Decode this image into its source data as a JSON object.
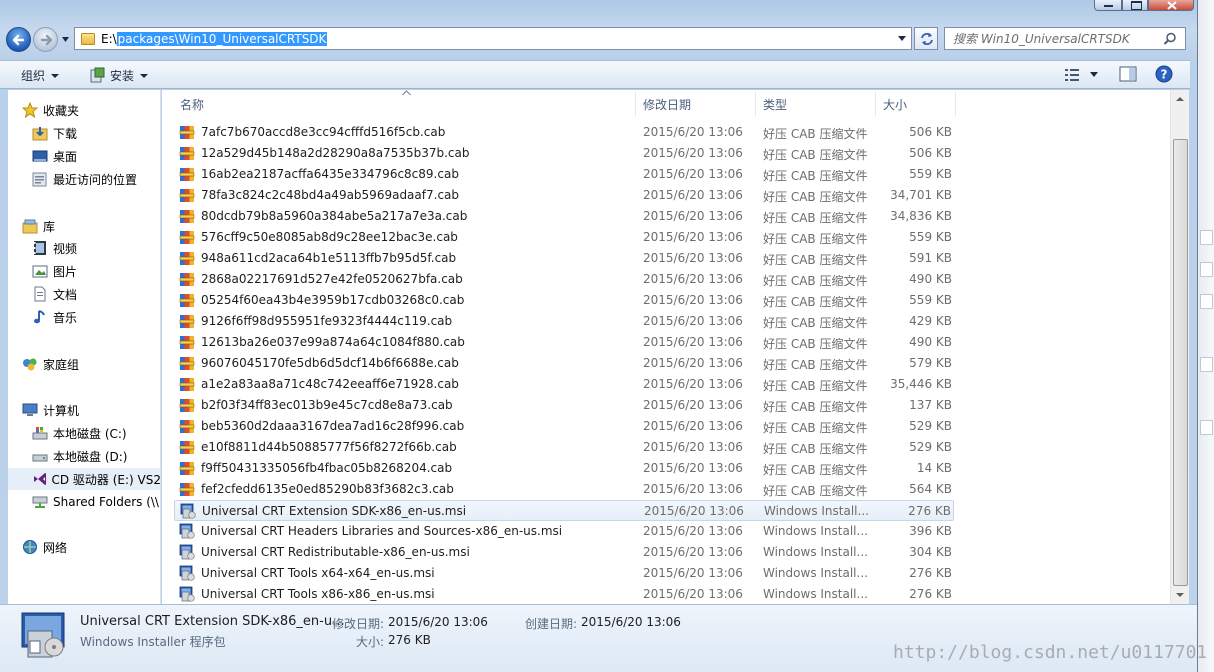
{
  "address": {
    "prefix": "E:\\",
    "selected_path": "packages\\Win10_UniversalCRTSDK"
  },
  "search": {
    "placeholder": "搜索 Win10_UniversalCRTSDK"
  },
  "toolbar": {
    "organize": "组织",
    "install": "安装"
  },
  "nav": {
    "favorites": "收藏夹",
    "downloads": "下载",
    "desktop": "桌面",
    "recent": "最近访问的位置",
    "libraries": "库",
    "videos": "视频",
    "pictures": "图片",
    "documents": "文档",
    "music": "音乐",
    "homegroup": "家庭组",
    "computer": "计算机",
    "drive_c": "本地磁盘 (C:)",
    "drive_d": "本地磁盘 (D:)",
    "drive_e": "CD 驱动器 (E:) VS2",
    "shared": "Shared Folders (\\\\",
    "network": "网络"
  },
  "columns": {
    "name": "名称",
    "date": "修改日期",
    "type": "类型",
    "size": "大小"
  },
  "files": [
    {
      "name": "7afc7b670accd8e3cc94cfffd516f5cb.cab",
      "date": "2015/6/20 13:06",
      "type": "好压 CAB 压缩文件",
      "size": "506 KB",
      "kind": "cab"
    },
    {
      "name": "12a529d45b148a2d28290a8a7535b37b.cab",
      "date": "2015/6/20 13:06",
      "type": "好压 CAB 压缩文件",
      "size": "506 KB",
      "kind": "cab"
    },
    {
      "name": "16ab2ea2187acffa6435e334796c8c89.cab",
      "date": "2015/6/20 13:06",
      "type": "好压 CAB 压缩文件",
      "size": "559 KB",
      "kind": "cab"
    },
    {
      "name": "78fa3c824c2c48bd4a49ab5969adaaf7.cab",
      "date": "2015/6/20 13:06",
      "type": "好压 CAB 压缩文件",
      "size": "34,701 KB",
      "kind": "cab"
    },
    {
      "name": "80dcdb79b8a5960a384abe5a217a7e3a.cab",
      "date": "2015/6/20 13:06",
      "type": "好压 CAB 压缩文件",
      "size": "34,836 KB",
      "kind": "cab"
    },
    {
      "name": "576cff9c50e8085ab8d9c28ee12bac3e.cab",
      "date": "2015/6/20 13:06",
      "type": "好压 CAB 压缩文件",
      "size": "559 KB",
      "kind": "cab"
    },
    {
      "name": "948a611cd2aca64b1e5113ffb7b95d5f.cab",
      "date": "2015/6/20 13:06",
      "type": "好压 CAB 压缩文件",
      "size": "591 KB",
      "kind": "cab"
    },
    {
      "name": "2868a02217691d527e42fe0520627bfa.cab",
      "date": "2015/6/20 13:06",
      "type": "好压 CAB 压缩文件",
      "size": "490 KB",
      "kind": "cab"
    },
    {
      "name": "05254f60ea43b4e3959b17cdb03268c0.cab",
      "date": "2015/6/20 13:06",
      "type": "好压 CAB 压缩文件",
      "size": "559 KB",
      "kind": "cab"
    },
    {
      "name": "9126f6ff98d955951fe9323f4444c119.cab",
      "date": "2015/6/20 13:06",
      "type": "好压 CAB 压缩文件",
      "size": "429 KB",
      "kind": "cab"
    },
    {
      "name": "12613ba26e037e99a874a64c1084f880.cab",
      "date": "2015/6/20 13:06",
      "type": "好压 CAB 压缩文件",
      "size": "490 KB",
      "kind": "cab"
    },
    {
      "name": "96076045170fe5db6d5dcf14b6f6688e.cab",
      "date": "2015/6/20 13:06",
      "type": "好压 CAB 压缩文件",
      "size": "579 KB",
      "kind": "cab"
    },
    {
      "name": "a1e2a83aa8a71c48c742eeaff6e71928.cab",
      "date": "2015/6/20 13:06",
      "type": "好压 CAB 压缩文件",
      "size": "35,446 KB",
      "kind": "cab"
    },
    {
      "name": "b2f03f34ff83ec013b9e45c7cd8e8a73.cab",
      "date": "2015/6/20 13:06",
      "type": "好压 CAB 压缩文件",
      "size": "137 KB",
      "kind": "cab"
    },
    {
      "name": "beb5360d2daaa3167dea7ad16c28f996.cab",
      "date": "2015/6/20 13:06",
      "type": "好压 CAB 压缩文件",
      "size": "529 KB",
      "kind": "cab"
    },
    {
      "name": "e10f8811d44b50885777f56f8272f66b.cab",
      "date": "2015/6/20 13:06",
      "type": "好压 CAB 压缩文件",
      "size": "529 KB",
      "kind": "cab"
    },
    {
      "name": "f9ff50431335056fb4fbac05b8268204.cab",
      "date": "2015/6/20 13:06",
      "type": "好压 CAB 压缩文件",
      "size": "14 KB",
      "kind": "cab"
    },
    {
      "name": "fef2cfedd6135e0ed85290b83f3682c3.cab",
      "date": "2015/6/20 13:06",
      "type": "好压 CAB 压缩文件",
      "size": "564 KB",
      "kind": "cab"
    },
    {
      "name": "Universal CRT Extension SDK-x86_en-us.msi",
      "date": "2015/6/20 13:06",
      "type": "Windows Install...",
      "size": "276 KB",
      "kind": "msi",
      "selected": true
    },
    {
      "name": "Universal CRT Headers Libraries and Sources-x86_en-us.msi",
      "date": "2015/6/20 13:06",
      "type": "Windows Install...",
      "size": "396 KB",
      "kind": "msi"
    },
    {
      "name": "Universal CRT Redistributable-x86_en-us.msi",
      "date": "2015/6/20 13:06",
      "type": "Windows Install...",
      "size": "304 KB",
      "kind": "msi"
    },
    {
      "name": "Universal CRT Tools x64-x64_en-us.msi",
      "date": "2015/6/20 13:06",
      "type": "Windows Install...",
      "size": "276 KB",
      "kind": "msi"
    },
    {
      "name": "Universal CRT Tools x86-x86_en-us.msi",
      "date": "2015/6/20 13:06",
      "type": "Windows Install...",
      "size": "276 KB",
      "kind": "msi"
    }
  ],
  "details": {
    "file_name": "Universal CRT Extension SDK-x86_en-u...",
    "file_type": "Windows Installer 程序包",
    "modified_label": "修改日期:",
    "modified_value": "2015/6/20 13:06",
    "created_label": "创建日期:",
    "created_value": "2015/6/20 13:06",
    "size_label": "大小:",
    "size_value": "276 KB"
  },
  "watermark": "http://blog.csdn.net/u0117701",
  "colors": {
    "selection_blue": "#3399ff",
    "frame": "#c6d9ee",
    "caption_close": "#c74d38"
  }
}
